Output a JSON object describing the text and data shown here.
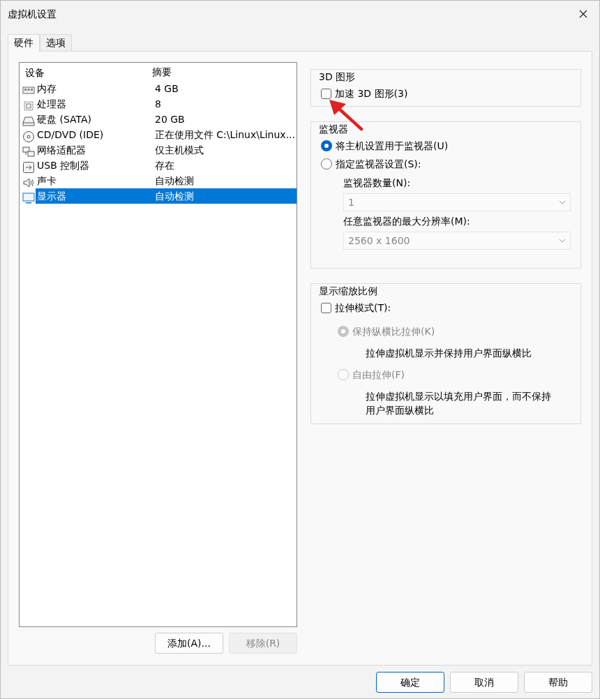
{
  "window": {
    "title": "虚拟机设置"
  },
  "tabs": [
    {
      "label": "硬件",
      "selected": true
    },
    {
      "label": "选项",
      "selected": false
    }
  ],
  "devices": {
    "columns": [
      "设备",
      "摘要"
    ],
    "rows": [
      {
        "kind": "memory",
        "name": "内存",
        "summary": "4 GB",
        "selected": false
      },
      {
        "kind": "cpu",
        "name": "处理器",
        "summary": "8",
        "selected": false
      },
      {
        "kind": "disk",
        "name": "硬盘 (SATA)",
        "summary": "20 GB",
        "selected": false
      },
      {
        "kind": "cd",
        "name": "CD/DVD (IDE)",
        "summary": "正在使用文件 C:\\Linux\\Linux...",
        "selected": false
      },
      {
        "kind": "network",
        "name": "网络适配器",
        "summary": "仅主机模式",
        "selected": false
      },
      {
        "kind": "usb",
        "name": "USB 控制器",
        "summary": "存在",
        "selected": false
      },
      {
        "kind": "sound",
        "name": "声卡",
        "summary": "自动检测",
        "selected": false
      },
      {
        "kind": "display",
        "name": "显示器",
        "summary": "自动检测",
        "selected": true
      }
    ]
  },
  "list_buttons": [
    {
      "label": "添加(A)...",
      "disabled": false
    },
    {
      "label": "移除(R)",
      "disabled": true
    }
  ],
  "graphics": {
    "title": "3D 图形",
    "accelerate": {
      "label": "加速 3D 图形(3)",
      "checked": false
    }
  },
  "monitor": {
    "title": "监视器",
    "options": [
      {
        "label": "将主机设置用于监视器(U)",
        "selected": true
      },
      {
        "label": "指定监视器设置(S):",
        "selected": false
      }
    ],
    "count": {
      "label": "监视器数量(N):",
      "value": "1",
      "disabled": true
    },
    "resolution": {
      "label": "任意监视器的最大分辨率(M):",
      "value": "2560 x 1600",
      "disabled": true
    }
  },
  "scaling": {
    "title": "显示缩放比例",
    "stretch": {
      "label": "拉伸模式(T):",
      "checked": false
    },
    "options": [
      {
        "label": "保持纵横比拉伸(K)",
        "selected": true,
        "disabled": true,
        "description": "拉伸虚拟机显示并保持用户界面纵横比"
      },
      {
        "label": "自由拉伸(F)",
        "selected": false,
        "disabled": true,
        "description": "拉伸虚拟机显示以填充用户界面，而不保持用户界面纵横比"
      }
    ]
  },
  "dialog_buttons": [
    {
      "label": "确定",
      "default": true
    },
    {
      "label": "取消",
      "default": false
    },
    {
      "label": "帮助",
      "default": false
    }
  ]
}
